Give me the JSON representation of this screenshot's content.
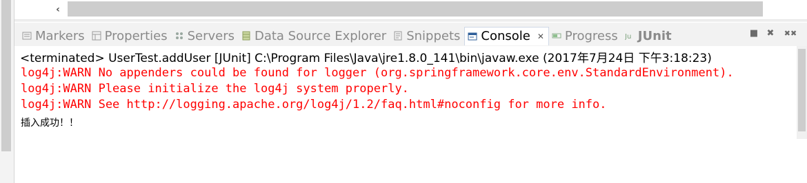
{
  "tabs": [
    {
      "label": "Markers",
      "icon": "markers-icon",
      "active": false
    },
    {
      "label": "Properties",
      "icon": "properties-icon",
      "active": false
    },
    {
      "label": "Servers",
      "icon": "servers-icon",
      "active": false
    },
    {
      "label": "Data Source Explorer",
      "icon": "database-icon",
      "active": false
    },
    {
      "label": "Snippets",
      "icon": "snippets-icon",
      "active": false
    },
    {
      "label": "Console",
      "icon": "console-icon",
      "active": true
    },
    {
      "label": "Progress",
      "icon": "progress-icon",
      "active": false
    },
    {
      "label": "JUnit",
      "icon": "junit-icon",
      "active": false
    }
  ],
  "console": {
    "status": "<terminated> UserTest.addUser [JUnit] C:\\Program Files\\Java\\jre1.8.0_141\\bin\\javaw.exe (2017年7月24日 下午3:18:23)",
    "lines": [
      "log4j:WARN No appenders could be found for logger (org.springframework.core.env.StandardEnvironment).",
      "log4j:WARN Please initialize the log4j system properly.",
      "log4j:WARN See http://logging.apache.org/log4j/1.2/faq.html#noconfig for more info."
    ],
    "message": "插入成功！！"
  },
  "colors": {
    "error_text": "#ff0000",
    "tab_inactive_text": "#8a8a8a"
  },
  "glyphs": {
    "scroll_left": "‹",
    "close": "✕",
    "stop": "■",
    "remove": "✖",
    "remove_all": "✖✖"
  }
}
